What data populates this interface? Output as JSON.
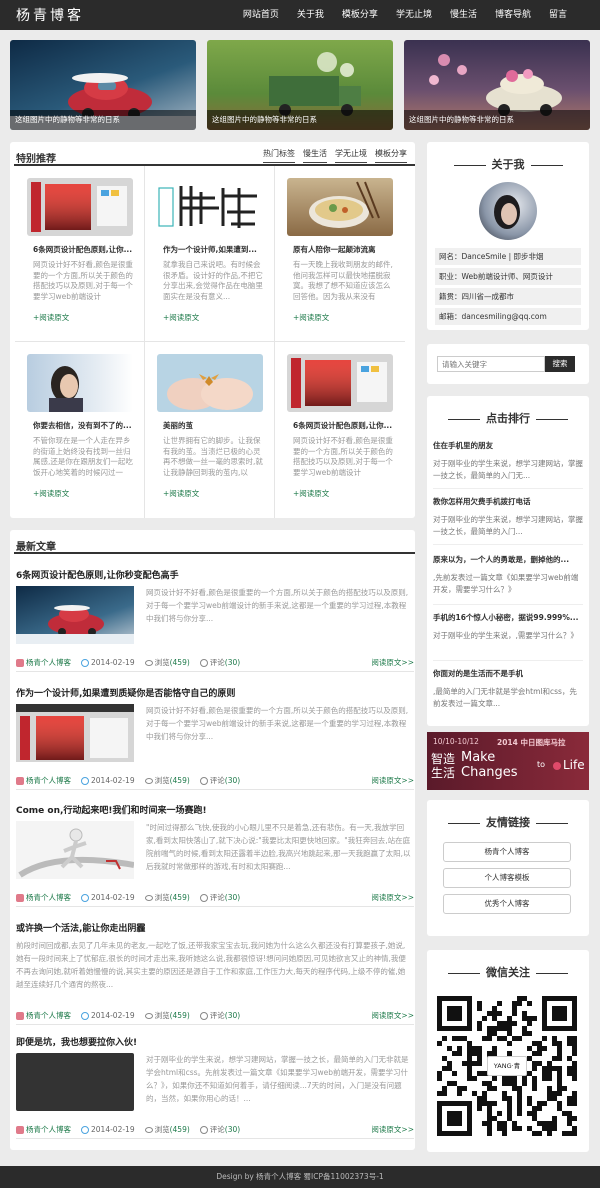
{
  "site": {
    "logo": "杨青博客"
  },
  "nav": [
    "网站首页",
    "关于我",
    "模板分享",
    "学无止境",
    "慢生活",
    "博客导航",
    "留言"
  ],
  "hero": [
    {
      "caption": "这组图片中的静物等非常的日系"
    },
    {
      "caption": "这组图片中的静物等非常的日系"
    },
    {
      "caption": "这组图片中的静物等非常的日系"
    }
  ],
  "featured": {
    "title": "特别推荐",
    "tabs": [
      "热门标签",
      "慢生活",
      "学无止境",
      "模板分享"
    ],
    "items": [
      {
        "title": "6条网页设计配色原则,让你...",
        "desc": "网页设计好不好看,颜色是很重要的一个方面,所以关于颜色的搭配技巧以及原则,对于每一个要学习web前端设计",
        "more": "+阅读原文"
      },
      {
        "title": "作为一个设计师,如果遭到...",
        "desc": "就拿我自己来说吧。有时候会很矛盾。设计好的作品,不把它分享出来,会觉得作品在电脑里面实在是没有意义...",
        "more": "+阅读原文"
      },
      {
        "title": "原有人陪你一起颠沛流离",
        "desc": "有一天晚上我收到朋友的邮件,他问我怎样可以最快地摆脱寂寞。我想了想不知道应该怎么回答他。因为我从来没有",
        "more": "+阅读原文"
      },
      {
        "title": "你要去相信，没有到不了的...",
        "desc": "不管你现在是一个人走在异乡的街道上始终没有找到一丝归属感,还是你在跟朋友们一起吃饭开心地笑着的时候闪过一",
        "more": "+阅读原文"
      },
      {
        "title": "美丽的茧",
        "desc": "让世界拥有它的脚步。让我保有我的茧。当溃烂已极的心灵再不想做一丝一毫的思索时,就让我静静回到我的茧内,以",
        "more": "+阅读原文"
      },
      {
        "title": "6条网页设计配色原则,让你...",
        "desc": "网页设计好不好看,颜色是很重要的一个方面,所以关于颜色的搭配技巧以及原则,对于每一个要学习web前端设计",
        "more": "+阅读原文"
      }
    ]
  },
  "latest": {
    "title": "最新文章",
    "articles": [
      {
        "title": "6条网页设计配色原则,让你秒变配色高手",
        "desc": "网页设计好不好看,颜色是很重要的一个方面,所以关于颜色的搭配技巧以及原则,对于每一个要学习web前端设计的新手来说,这都是一个重要的学习过程,本教程中我们将与你分享...",
        "author": "杨青个人博客",
        "date": "2014-02-19",
        "views_label": "浏览",
        "views": "(459)",
        "comments_label": "评论",
        "comments": "(30)",
        "more": "阅读原文>>"
      },
      {
        "title": "作为一个设计师,如果遭到质疑你是否能恪守自己的原则",
        "desc": "网页设计好不好看,颜色是很重要的一个方面,所以关于颜色的搭配技巧以及原则,对于每一个要学习web前端设计的新手来说,这都是一个重要的学习过程,本教程中我们将与你分享...",
        "author": "杨青个人博客",
        "date": "2014-02-19",
        "views_label": "浏览",
        "views": "(459)",
        "comments_label": "评论",
        "comments": "(30)",
        "more": "阅读原文>>"
      },
      {
        "title": "Come on,行动起来吧!我们和时间来一场赛跑!",
        "desc": "\"时间过得那么飞快,使我的小心眼儿里不只是着急,还有悲伤。有一天,我放学回家,看到太阳快落山了,就下决心说:\"我要比太阳更快地回家。\"我狂奔回去,站在庭院前喘气的时候,看到太阳还露着半边脸,我高兴地跳起来,那一天我跑赢了太阳,以后我就时常做那样的游戏,有时和太阳赛跑...",
        "author": "杨青个人博客",
        "date": "2014-02-19",
        "views_label": "浏览",
        "views": "(459)",
        "comments_label": "评论",
        "comments": "(30)",
        "more": "阅读原文>>"
      },
      {
        "title": "或许换一个活法,能让你走出阴霾",
        "desc": "前段时间回成都,去见了几年未见的老友,一起吃了饭,还带我家宝宝去玩,我问她为什么这么久都还没有打算要孩子,她说,她有一段时间来上了忧郁症,很长的时间才走出来,我听她这么说,我都很惊讶!想问问她原因,可见她欲言又止的神情,我便不再去询问她,就听着她慢慢的说,其实主要的原因还是源自于工作和家庭,工作压力大,每天的程序代码,上级不停的催,她越至连续好几个通宵的熬夜...",
        "author": "杨青个人博客",
        "date": "2014-02-19",
        "views_label": "浏览",
        "views": "(459)",
        "comments_label": "评论",
        "comments": "(30)",
        "more": "阅读原文>>"
      },
      {
        "title": "即便是坑，我也想要拉你入伙!",
        "desc": "对于刚毕业的学生来说，想学习建网站，掌握一技之长，最简单的入门无非就是学会html和css。先前发表过一篇文章《如果要学习web前端开发，需要学习什么？》，如果你还不知道如何着手，请仔细阅读...7天的时间，入门是没有问题的，当然，如果你用心的话！...",
        "author": "杨青个人博客",
        "date": "2014-02-19",
        "views_label": "浏览",
        "views": "(459)",
        "comments_label": "评论",
        "comments": "(30)",
        "more": "阅读原文>>"
      }
    ]
  },
  "about": {
    "title": "关于我",
    "rows": [
      "网名：DanceSmile | 即步非烟",
      "职业：Web前端设计师、网页设计",
      "籍贯：四川省—成都市",
      "邮箱：dancesmiling@qq.com"
    ]
  },
  "search": {
    "placeholder": "请输入关键字",
    "button": "搜索"
  },
  "ranking": {
    "title": "点击排行",
    "items": [
      {
        "title": "住在手机里的朋友",
        "desc": "对于刚毕业的学生来说，想学习建网站，掌握一技之长，最简单的入门无..."
      },
      {
        "title": "教你怎样用欠费手机拨打电话",
        "desc": "对于刚毕业的学生来说，想学习建网站，掌握一技之长，最简单的入门..."
      },
      {
        "title": "原来以为，一个人的勇敢是，删掉他的...",
        "desc": ",先前发表过一篇文章《如果要学习web前端开发，需要学习什么？》"
      },
      {
        "title": "手机的16个惊人小秘密，据说99.999%...",
        "desc": "对于刚毕业的学生来说，,需要学习什么？》"
      },
      {
        "title": "你面对的是生活而不是手机",
        "desc": ",最简单的入门无非就是学会html和css，先前发表过一篇文章..."
      }
    ]
  },
  "banner": {
    "date": "10/10-10/12",
    "title": "2014 中日图库马拉",
    "line1": "智造",
    "line2": "生活",
    "slogan1": "Make",
    "slogan2": "Changes",
    "slogan3": "to",
    "slogan4": "Life"
  },
  "links": {
    "title": "友情链接",
    "items": [
      "杨青个人博客",
      "个人博客模板",
      "优秀个人博客"
    ]
  },
  "wechat": {
    "title": "微信关注",
    "qr_label": "YANG·青"
  },
  "footer": {
    "text": "Design by 杨青个人博客 蜀ICP备11002373号-1"
  },
  "colors": {
    "dark": "#2b2b2b",
    "accent": "#1e7a4a",
    "pink": "#e04a6a"
  }
}
